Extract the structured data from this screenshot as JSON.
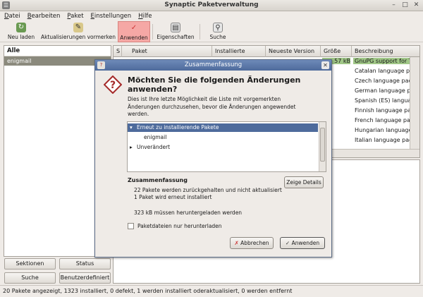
{
  "window": {
    "title": "Synaptic Paketverwaltung"
  },
  "menu": [
    "Datei",
    "Bearbeiten",
    "Paket",
    "Einstellungen",
    "Hilfe"
  ],
  "toolbar": {
    "reload": "Neu laden",
    "mark_updates": "Aktualisierungen vormerken",
    "apply": "Anwenden",
    "properties": "Eigenschaften",
    "search": "Suche"
  },
  "left": {
    "header": "Alle",
    "items": [
      "enigmail"
    ],
    "btn_sections": "Sektionen",
    "btn_status": "Status",
    "btn_search": "Suche",
    "btn_custom": "Benutzerdefiniert"
  },
  "packages": {
    "columns": [
      "S",
      "Paket",
      "Installierte Version",
      "Neueste Version",
      "Größe",
      "Beschreibung"
    ],
    "rows": [
      {
        "size": "57 kB",
        "desc": "GnuPG support for Th"
      },
      {
        "size": "",
        "desc": "Catalan language pac"
      },
      {
        "size": "",
        "desc": "Czech language pack"
      },
      {
        "size": "",
        "desc": "German language pack"
      },
      {
        "size": "",
        "desc": "Spanish (ES) language"
      },
      {
        "size": "",
        "desc": "Finnish language pack"
      },
      {
        "size": "",
        "desc": "French language pack"
      },
      {
        "size": "",
        "desc": "Hungarian language p"
      },
      {
        "size": "",
        "desc": "Italian language pack"
      }
    ]
  },
  "statusbar": "20 Pakete angezeigt, 1323 installiert, 0 defekt, 1 werden installiert oderaktualisiert, 0 werden entfernt",
  "dialog": {
    "title": "Zusammenfassung",
    "heading": "Möchten Sie die folgenden Änderungen anwenden?",
    "intro": "Dies ist Ihre letzte Möglichkeit die Liste mit vorgemerkten Änderungen durchzusehen, bevor die Änderungen angewendet werden.",
    "tree": {
      "group_reinstall": "Erneut zu installierende Pakete",
      "item": "enigmail",
      "group_unchanged": "Unverändert"
    },
    "summary_title": "Zusammenfassung",
    "details_button": "Zeige Details",
    "summary_lines": [
      "22 Pakete werden zurückgehalten und nicht aktualisiert",
      "1 Paket wird erneut installiert",
      "323 kB müssen heruntergeladen werden"
    ],
    "download_only": "Paketdateien nur herunterladen",
    "cancel": "Abbrechen",
    "apply": "Anwenden"
  },
  "colors": {
    "accent": "#4e6b9c",
    "highlight_row": "#a0c787",
    "active_tool": "#f5a8a5"
  }
}
